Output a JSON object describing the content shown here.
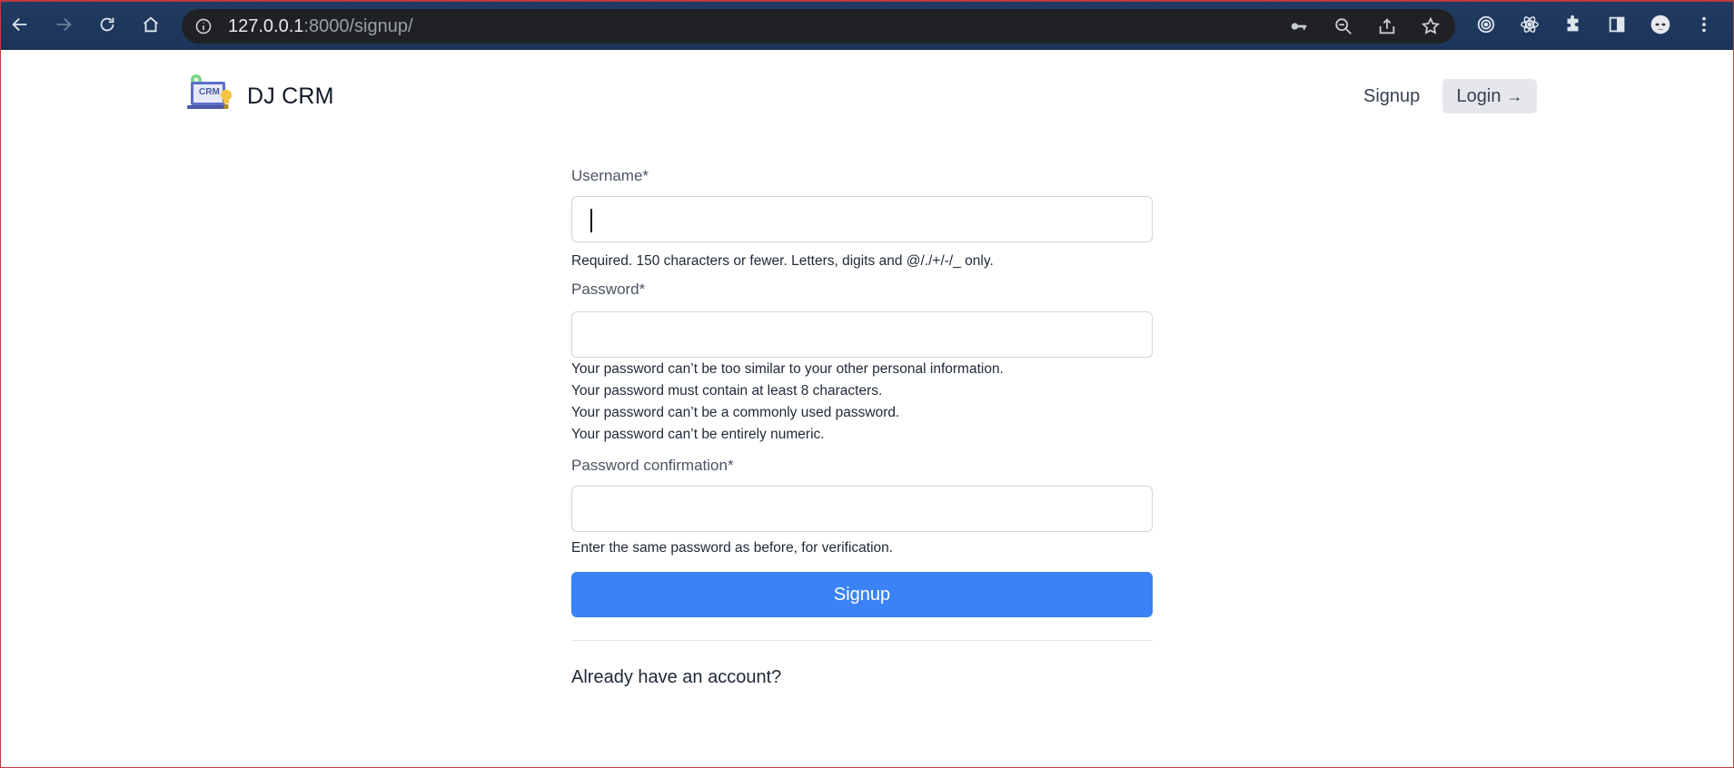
{
  "browser": {
    "url_host": "127.0.0.1",
    "url_rest": ":8000/signup/",
    "icons": [
      "back-icon",
      "forward-icon",
      "reload-icon",
      "home-icon",
      "site-info-icon",
      "key-icon",
      "zoom-out-icon",
      "share-icon",
      "bookmark-star-icon",
      "extension-target-icon",
      "extension-react-icon",
      "extensions-puzzle-icon",
      "side-panel-icon",
      "profile-avatar",
      "menu-kebab-icon"
    ]
  },
  "header": {
    "logo_text": "CRM",
    "brand": "DJ CRM",
    "signup_link": "Signup",
    "login_button": "Login",
    "login_arrow": "→"
  },
  "form": {
    "username_label": "Username*",
    "username_value": "",
    "username_help": "Required. 150 characters or fewer. Letters, digits and @/./+/-/_ only.",
    "password_label": "Password*",
    "password_value": "",
    "password_help": [
      "Your password can’t be too similar to your other personal information.",
      "Your password must contain at least 8 characters.",
      "Your password can’t be a commonly used password.",
      "Your password can’t be entirely numeric."
    ],
    "password2_label": "Password confirmation*",
    "password2_value": "",
    "password2_help": "Enter the same password as before, for verification.",
    "submit_label": "Signup",
    "already_text": "Already have an account?"
  },
  "colors": {
    "primary": "#3b82f6",
    "login_bg": "#e5e7eb",
    "chrome_bg": "#1d3557"
  }
}
